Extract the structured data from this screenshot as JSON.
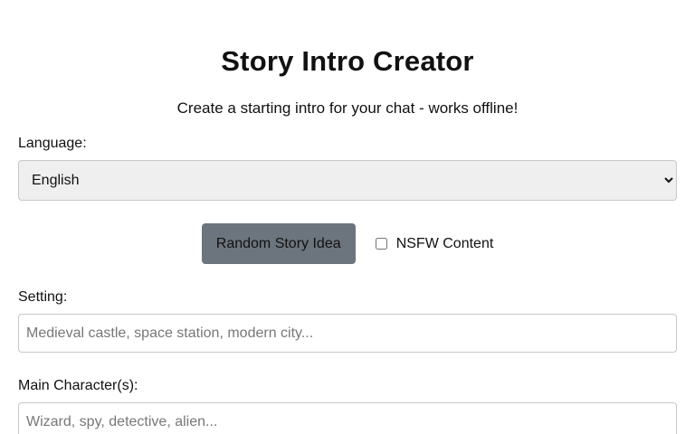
{
  "header": {
    "title": "Story Intro Creator",
    "subtitle": "Create a starting intro for your chat - works offline!"
  },
  "language": {
    "label": "Language:",
    "selected": "English",
    "options": [
      "English"
    ]
  },
  "actions": {
    "random_label": "Random Story Idea",
    "nsfw_label": "NSFW Content",
    "nsfw_checked": false
  },
  "setting": {
    "label": "Setting:",
    "value": "",
    "placeholder": "Medieval castle, space station, modern city..."
  },
  "characters": {
    "label": "Main Character(s):",
    "value": "",
    "placeholder": "Wizard, spy, detective, alien..."
  },
  "colors": {
    "button_bg": "#6c757d",
    "select_bg": "#efefef",
    "border": "#c8c8c8"
  }
}
